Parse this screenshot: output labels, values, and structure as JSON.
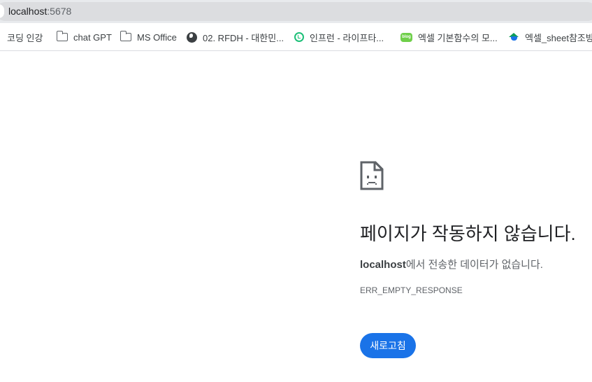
{
  "address_bar": {
    "host": "localhost",
    "port": ":5678"
  },
  "bookmarks": [
    {
      "label": "코딩 인강",
      "icon": "folder-icon"
    },
    {
      "label": "chat GPT",
      "icon": "folder-icon"
    },
    {
      "label": "MS Office",
      "icon": "folder-icon"
    },
    {
      "label": "02. RFDH - 대한민...",
      "icon": "globe-icon"
    },
    {
      "label": "인프런 - 라이프타...",
      "icon": "inflearn-icon"
    },
    {
      "label": "엑셀 기본함수의 모...",
      "icon": "blog-icon"
    },
    {
      "label": "엑셀_sheet참조방",
      "icon": "graduation-cap-icon"
    }
  ],
  "error": {
    "icon": "sad-page-icon",
    "title": "페이지가 작동하지 않습니다.",
    "desc_host": "localhost",
    "desc_rest": "에서 전송한 데이터가 없습니다.",
    "code": "ERR_EMPTY_RESPONSE",
    "reload_label": "새로고침"
  },
  "colors": {
    "accent": "#1a73e8",
    "toolbar": "#e8eaed",
    "text": "#202124",
    "secondary_text": "#5f6368"
  }
}
